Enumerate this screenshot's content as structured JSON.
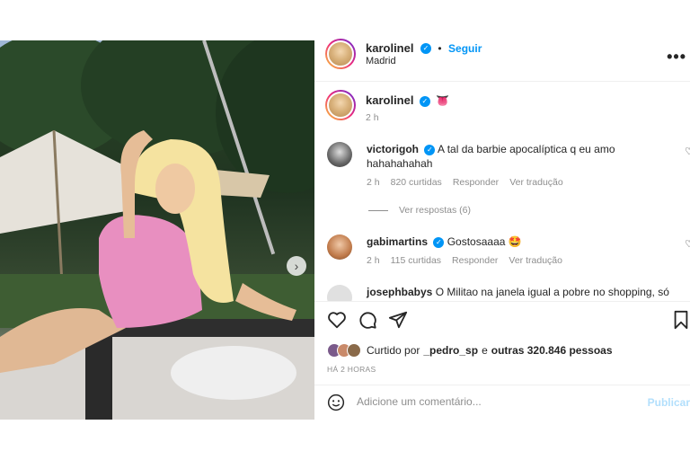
{
  "header": {
    "username": "karolinel",
    "follow_label": "Seguir",
    "location": "Madrid",
    "more_glyph": "•••"
  },
  "caption": {
    "username": "karolinel",
    "emoji": "👅",
    "time": "2 h"
  },
  "comments": [
    {
      "username": "victorigoh",
      "text": "A tal da barbie apocalíptica q eu amo hahahahahah",
      "time": "2 h",
      "likes": "820 curtidas",
      "reply": "Responder",
      "translate": "Ver tradução",
      "view_replies": "Ver respostas (6)"
    },
    {
      "username": "gabimartins",
      "text": "Gostosaaaa 🤩",
      "time": "2 h",
      "likes": "115 curtidas",
      "reply": "Responder",
      "translate": "Ver tradução"
    },
    {
      "username": "josephbabys",
      "text": "O Militao na janela igual a pobre no shopping, só"
    }
  ],
  "likes": {
    "prefix": "Curtido por",
    "user": "_pedro_sp",
    "connector": "e",
    "others": "outras 320.846 pessoas"
  },
  "posted_ago": "HÁ 2 HORAS",
  "comment_input": {
    "placeholder": "Adicione um comentário..."
  },
  "publish_label": "Publicar",
  "carousel": {
    "next_glyph": "›",
    "slide_count": 2,
    "active_slide": 1
  },
  "icons": [
    "heart-icon",
    "comment-icon",
    "share-icon",
    "bookmark-icon",
    "emoji-icon",
    "user-tag-icon",
    "verified-icon",
    "chevron-right-icon",
    "more-options-icon"
  ],
  "colors": {
    "accent": "#0095f6",
    "muted": "#8e8e8e",
    "text": "#262626",
    "swimsuit": "#e88fc0",
    "publish_disabled": "#b2dffc"
  }
}
